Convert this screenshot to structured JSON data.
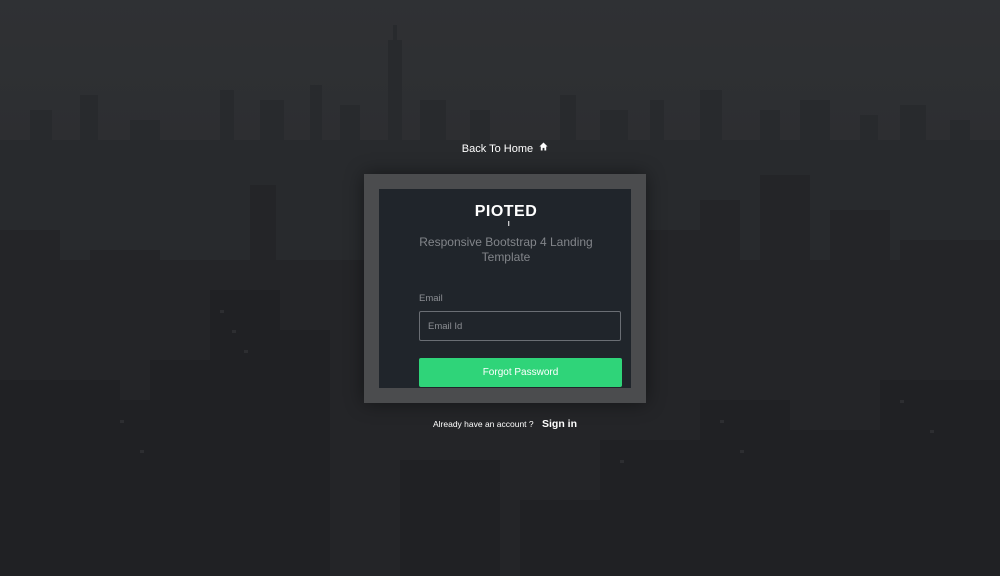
{
  "header": {
    "back_home_label": "Back To Home",
    "back_home_icon": "home-icon"
  },
  "card": {
    "logo_prefix": "PIO",
    "logo_t": "T",
    "logo_suffix": "ED",
    "subtitle": "Responsive Bootstrap 4 Landing Template",
    "email_label": "Email",
    "email_placeholder": "Email Id",
    "email_value": "",
    "submit_label": "Forgot Password"
  },
  "footer": {
    "prompt": "Already have an account ?",
    "signin_label": "Sign in"
  },
  "colors": {
    "accent": "#2fd479",
    "card_bg": "#20252b",
    "frame_bg": "#4b4c4e",
    "page_bg": "#2c2d30"
  }
}
